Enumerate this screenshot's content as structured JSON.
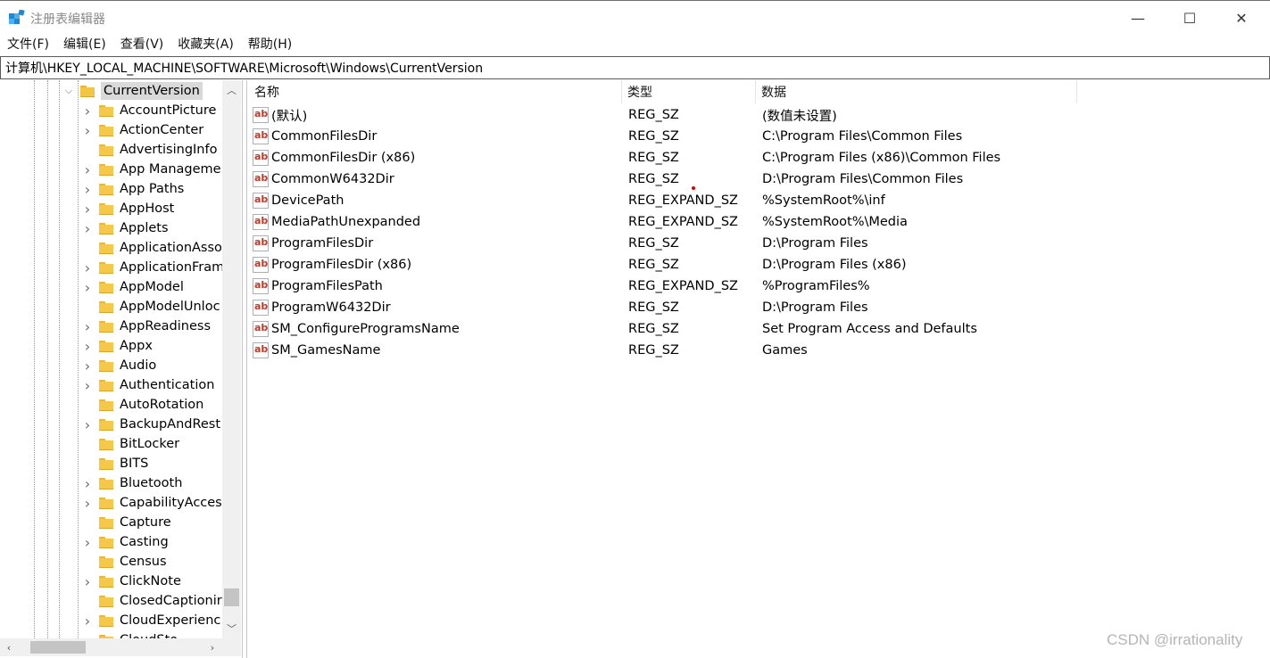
{
  "window": {
    "title": "注册表编辑器",
    "minimize_glyph": "—",
    "maximize_glyph": "☐",
    "close_glyph": "✕"
  },
  "menu": [
    "文件(F)",
    "编辑(E)",
    "查看(V)",
    "收藏夹(A)",
    "帮助(H)"
  ],
  "address": "计算机\\HKEY_LOCAL_MACHINE\\SOFTWARE\\Microsoft\\Windows\\CurrentVersion",
  "tree": {
    "current": "CurrentVersion",
    "items": [
      {
        "label": "AccountPicture",
        "expandable": true
      },
      {
        "label": "ActionCenter",
        "expandable": true
      },
      {
        "label": "AdvertisingInfo",
        "expandable": false
      },
      {
        "label": "App Manageme",
        "expandable": true
      },
      {
        "label": "App Paths",
        "expandable": true
      },
      {
        "label": "AppHost",
        "expandable": true
      },
      {
        "label": "Applets",
        "expandable": true
      },
      {
        "label": "ApplicationAsso",
        "expandable": false
      },
      {
        "label": "ApplicationFram",
        "expandable": true
      },
      {
        "label": "AppModel",
        "expandable": true
      },
      {
        "label": "AppModelUnloc",
        "expandable": false
      },
      {
        "label": "AppReadiness",
        "expandable": true
      },
      {
        "label": "Appx",
        "expandable": true
      },
      {
        "label": "Audio",
        "expandable": true
      },
      {
        "label": "Authentication",
        "expandable": true
      },
      {
        "label": "AutoRotation",
        "expandable": false
      },
      {
        "label": "BackupAndRest",
        "expandable": true
      },
      {
        "label": "BitLocker",
        "expandable": false
      },
      {
        "label": "BITS",
        "expandable": false
      },
      {
        "label": "Bluetooth",
        "expandable": true
      },
      {
        "label": "CapabilityAcces",
        "expandable": true
      },
      {
        "label": "Capture",
        "expandable": false
      },
      {
        "label": "Casting",
        "expandable": true
      },
      {
        "label": "Census",
        "expandable": false
      },
      {
        "label": "ClickNote",
        "expandable": true
      },
      {
        "label": "ClosedCaptionir",
        "expandable": false
      },
      {
        "label": "CloudExperienc",
        "expandable": true
      },
      {
        "label": "CloudSto",
        "expandable": false
      }
    ]
  },
  "columns": {
    "name": "名称",
    "type": "类型",
    "data": "数据"
  },
  "values": [
    {
      "name": "(默认)",
      "type": "REG_SZ",
      "data": "(数值未设置)"
    },
    {
      "name": "CommonFilesDir",
      "type": "REG_SZ",
      "data": "C:\\Program Files\\Common Files"
    },
    {
      "name": "CommonFilesDir (x86)",
      "type": "REG_SZ",
      "data": "C:\\Program Files (x86)\\Common Files"
    },
    {
      "name": "CommonW6432Dir",
      "type": "REG_SZ",
      "data": "D:\\Program Files\\Common Files"
    },
    {
      "name": "DevicePath",
      "type": "REG_EXPAND_SZ",
      "data": "%SystemRoot%\\inf"
    },
    {
      "name": "MediaPathUnexpanded",
      "type": "REG_EXPAND_SZ",
      "data": "%SystemRoot%\\Media"
    },
    {
      "name": "ProgramFilesDir",
      "type": "REG_SZ",
      "data": "D:\\Program Files"
    },
    {
      "name": "ProgramFilesDir (x86)",
      "type": "REG_SZ",
      "data": "D:\\Program Files (x86)"
    },
    {
      "name": "ProgramFilesPath",
      "type": "REG_EXPAND_SZ",
      "data": "%ProgramFiles%"
    },
    {
      "name": "ProgramW6432Dir",
      "type": "REG_SZ",
      "data": "D:\\Program Files"
    },
    {
      "name": "SM_ConfigureProgramsName",
      "type": "REG_SZ",
      "data": "Set Program Access and Defaults"
    },
    {
      "name": "SM_GamesName",
      "type": "REG_SZ",
      "data": "Games"
    }
  ],
  "value_icon_text": "ab",
  "watermark": "CSDN @irrationality",
  "colors": {
    "folder": "#f5c84a",
    "selection": "#d9d9d9",
    "app_icon": "#1e88d6"
  }
}
